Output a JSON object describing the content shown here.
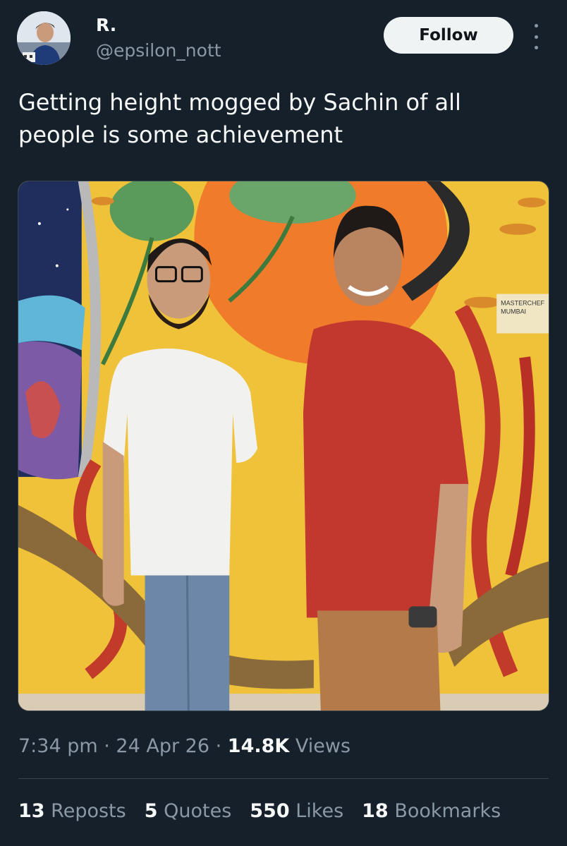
{
  "author": {
    "display_name": "R.",
    "handle": "@epsilon_nott",
    "avatar_icon": "avatar-photo"
  },
  "follow_label": "Follow",
  "more_icon": "more-vertical-icon",
  "tweet": {
    "text": "Getting height mogged by Sachin of all people is some achievement"
  },
  "media": {
    "sign_line1": "MASTERCHEF",
    "sign_line2": "MUMBAI"
  },
  "meta": {
    "time": "7:34 pm",
    "date": "24 Apr 26",
    "views_count": "14.8K",
    "views_label": "Views"
  },
  "stats": {
    "reposts_count": "13",
    "reposts_label": "Reposts",
    "quotes_count": "5",
    "quotes_label": "Quotes",
    "likes_count": "550",
    "likes_label": "Likes",
    "bookmarks_count": "18",
    "bookmarks_label": "Bookmarks"
  },
  "colors": {
    "background": "#15202b",
    "text_primary": "#f7f9f9",
    "text_secondary": "#8b98a5",
    "divider": "#38444d",
    "follow_bg": "#eff3f4"
  }
}
